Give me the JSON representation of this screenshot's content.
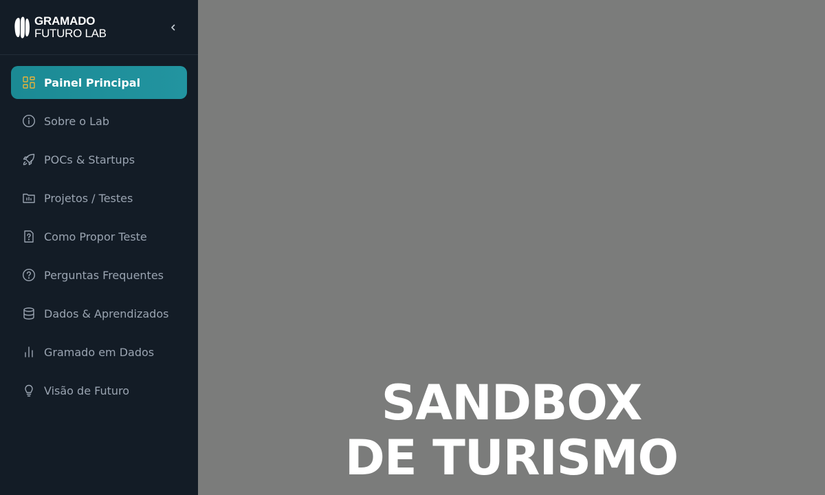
{
  "brand": {
    "line1": "GRAMADO",
    "line2": "FUTURO LAB"
  },
  "sidebar": {
    "collapse_icon": "chevron-left-icon",
    "items": [
      {
        "label": "Painel Principal",
        "icon": "dashboard-grid-icon",
        "active": true
      },
      {
        "label": "Sobre o Lab",
        "icon": "info-icon",
        "active": false
      },
      {
        "label": "POCs & Startups",
        "icon": "rocket-icon",
        "active": false
      },
      {
        "label": "Projetos / Testes",
        "icon": "folder-chart-icon",
        "active": false
      },
      {
        "label": "Como Propor Teste",
        "icon": "file-question-icon",
        "active": false
      },
      {
        "label": "Perguntas Frequentes",
        "icon": "help-circle-icon",
        "active": false
      },
      {
        "label": "Dados & Aprendizados",
        "icon": "database-icon",
        "active": false
      },
      {
        "label": "Gramado em Dados",
        "icon": "bar-chart-icon",
        "active": false
      },
      {
        "label": "Visão de Futuro",
        "icon": "lightbulb-icon",
        "active": false
      }
    ]
  },
  "hero": {
    "line1": "SANDBOX",
    "line2": "DE TURISMO"
  },
  "colors": {
    "sidebar_bg": "#131c26",
    "active_item": "#1b8a94",
    "active_icon": "#e8b33a",
    "main_bg": "#7b7c7b"
  }
}
